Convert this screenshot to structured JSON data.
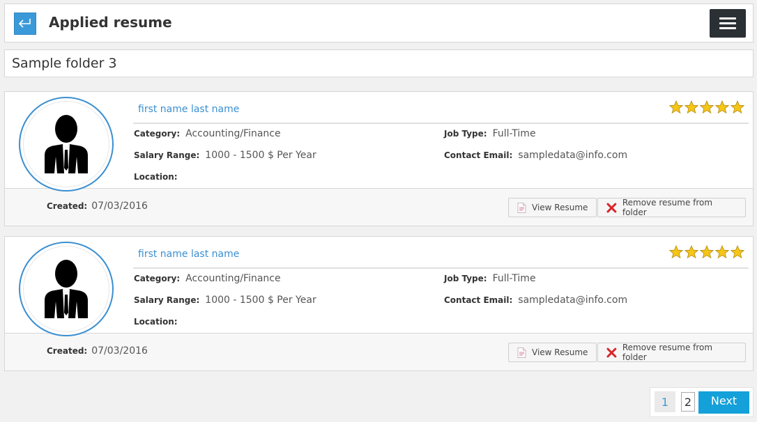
{
  "header": {
    "title": "Applied resume"
  },
  "folder": {
    "name": "Sample folder 3"
  },
  "labels": {
    "category": "Category:",
    "job_type": "Job Type:",
    "salary_range": "Salary Range:",
    "contact_email": "Contact Email:",
    "location": "Location:",
    "created": "Created:",
    "view_resume": "View Resume",
    "remove_resume": "Remove resume from folder"
  },
  "icons": {
    "back": "back-arrow-icon",
    "menu": "hamburger-menu-icon",
    "avatar": "user-avatar-icon",
    "star": "star-icon",
    "document": "document-icon",
    "remove": "red-x-icon"
  },
  "colors": {
    "accent": "#3a8fd1",
    "next_button": "#14a0d9",
    "star": "#f5c518",
    "remove": "#d9252a"
  },
  "resumes": [
    {
      "name": "first name last name",
      "rating": 5,
      "category": "Accounting/Finance",
      "job_type": "Full-Time",
      "salary_range": "1000 - 1500 $ Per Year",
      "contact_email": "sampledata@info.com",
      "location": "",
      "created": "07/03/2016"
    },
    {
      "name": "first name last name",
      "rating": 5,
      "category": "Accounting/Finance",
      "job_type": "Full-Time",
      "salary_range": "1000 - 1500 $ Per Year",
      "contact_email": "sampledata@info.com",
      "location": "",
      "created": "07/03/2016"
    }
  ],
  "pagination": {
    "current": "1",
    "pages": [
      "1",
      "2"
    ],
    "next_label": "Next"
  }
}
